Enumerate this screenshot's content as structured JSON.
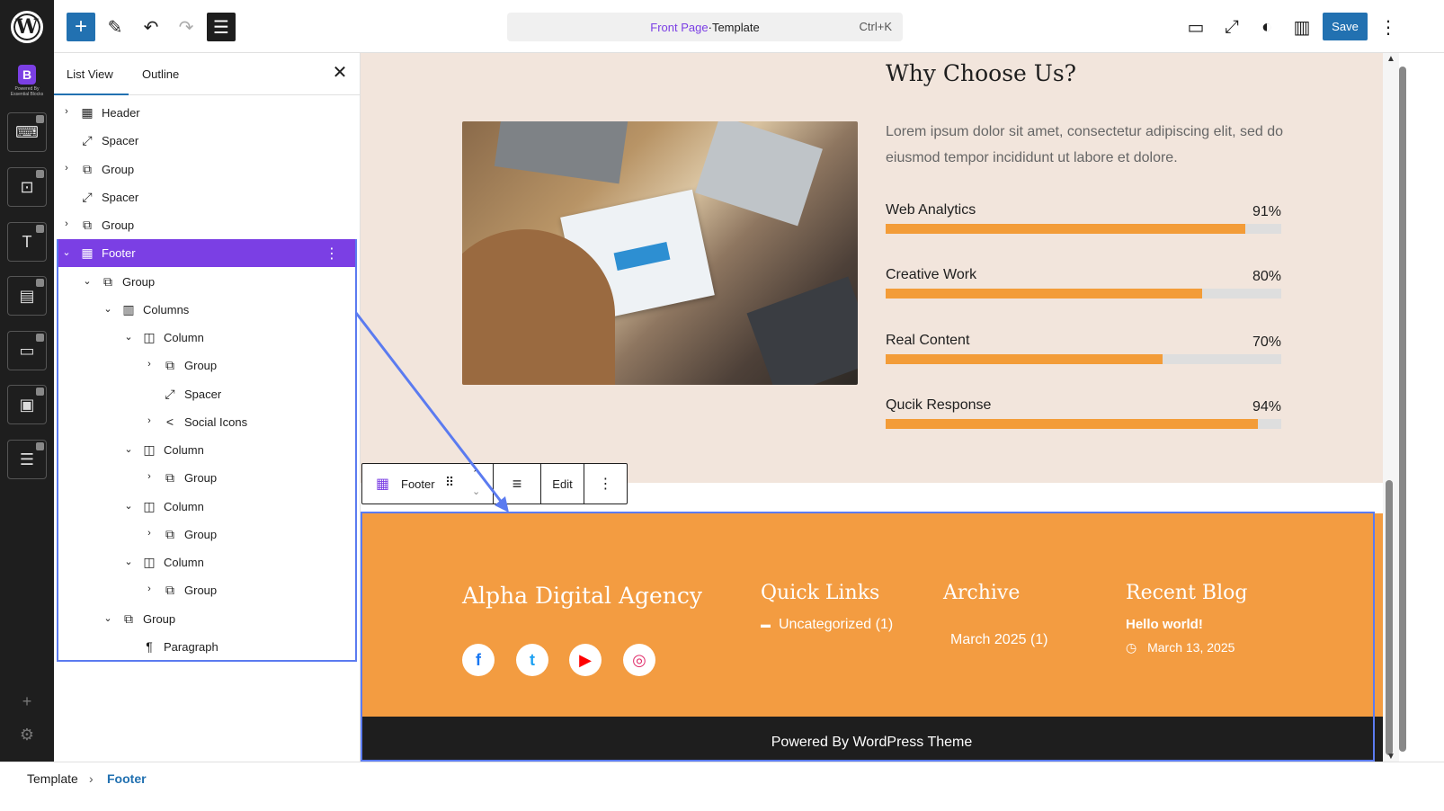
{
  "topbar": {
    "add_icon": "+",
    "pen_icon": "✎",
    "undo_icon": "↶",
    "redo_icon": "↷",
    "list_icon": "☰",
    "doc_title": "Front Page",
    "doc_separator": " · ",
    "doc_type": "Template",
    "shortcut": "Ctrl+K",
    "save_label": "Save",
    "desktop_icon": "▭",
    "fullscreen_icon": "⤢",
    "styles_icon": "◐",
    "settings_icon": "▥",
    "more_icon": "⋮"
  },
  "leftbar": {
    "wp_logo": "W",
    "eb_mark": "B",
    "eb_caption": "Powered By Essential Blocks",
    "tools": [
      "⌨",
      "⊡",
      "T",
      "▤",
      "▭",
      "▣",
      "☰"
    ],
    "add_icon": "+",
    "gear_icon": "⚙"
  },
  "panel": {
    "tab_list": "List View",
    "tab_outline": "Outline",
    "close_icon": "✕",
    "items": [
      {
        "label": "Header",
        "icon": "▦",
        "chev": "›",
        "level": 0
      },
      {
        "label": "Spacer",
        "icon": "⤢",
        "chev": "",
        "level": 0
      },
      {
        "label": "Group",
        "icon": "⧉",
        "chev": "›",
        "level": 0
      },
      {
        "label": "Spacer",
        "icon": "⤢",
        "chev": "",
        "level": 0
      },
      {
        "label": "Group",
        "icon": "⧉",
        "chev": "›",
        "level": 0
      },
      {
        "label": "Footer",
        "icon": "▦",
        "chev": "⌄",
        "level": 0
      },
      {
        "label": "Group",
        "icon": "⧉",
        "chev": "⌄",
        "level": 1
      },
      {
        "label": "Columns",
        "icon": "▥",
        "chev": "⌄",
        "level": 2
      },
      {
        "label": "Column",
        "icon": "◫",
        "chev": "⌄",
        "level": 3
      },
      {
        "label": "Group",
        "icon": "⧉",
        "chev": "›",
        "level": 4
      },
      {
        "label": "Spacer",
        "icon": "⤢",
        "chev": "",
        "level": 4
      },
      {
        "label": "Social Icons",
        "icon": "<",
        "chev": "›",
        "level": 4
      },
      {
        "label": "Column",
        "icon": "◫",
        "chev": "⌄",
        "level": 3
      },
      {
        "label": "Group",
        "icon": "⧉",
        "chev": "›",
        "level": 4
      },
      {
        "label": "Column",
        "icon": "◫",
        "chev": "⌄",
        "level": 3
      },
      {
        "label": "Group",
        "icon": "⧉",
        "chev": "›",
        "level": 4
      },
      {
        "label": "Column",
        "icon": "◫",
        "chev": "⌄",
        "level": 3
      },
      {
        "label": "Group",
        "icon": "⧉",
        "chev": "›",
        "level": 4
      },
      {
        "label": "Group",
        "icon": "⧉",
        "chev": "⌄",
        "level": 2
      },
      {
        "label": "Paragraph",
        "icon": "¶",
        "chev": "",
        "level": 3
      }
    ],
    "kebab": "⋮"
  },
  "why": {
    "title": "Why Choose Us?",
    "text": "Lorem ipsum dolor sit amet, consectetur adipiscing elit, sed do eiusmod tempor incididunt ut labore et dolore.",
    "skills": [
      {
        "name": "Web Analytics",
        "pct": "91%",
        "value": 0.91
      },
      {
        "name": "Creative Work",
        "pct": "80%",
        "value": 0.8
      },
      {
        "name": "Real Content",
        "pct": "70%",
        "value": 0.7
      },
      {
        "name": "Qucik Response",
        "pct": "94%",
        "value": 0.94
      }
    ]
  },
  "block_toolbar": {
    "icon": "▦",
    "label": "Footer",
    "drag_icon": "⠿",
    "up_icon": "⌃",
    "down_icon": "⌄",
    "align_icon": "≡",
    "edit_label": "Edit",
    "more_icon": "⋮"
  },
  "footer": {
    "brand": "Alpha Digital Agency",
    "social": [
      {
        "name": "facebook",
        "glyph": "f",
        "color": "#1877f2"
      },
      {
        "name": "twitter",
        "glyph": "t",
        "color": "#1da1f2"
      },
      {
        "name": "youtube",
        "glyph": "▶",
        "color": "#ff0000"
      },
      {
        "name": "instagram",
        "glyph": "◎",
        "color": "#e1306c"
      }
    ],
    "quick_links_title": "Quick Links",
    "quick_link": "Uncategorized (1)",
    "folder_icon": "▬",
    "archive_title": "Archive",
    "archive_item": "March 2025 (1)",
    "recent_title": "Recent Blog",
    "post_title": "Hello world!",
    "clock_icon": "◷",
    "post_date": "March 13, 2025",
    "copyright": "Powered By WordPress Theme"
  },
  "breadcrumb": {
    "root": "Template",
    "separator": "›",
    "current": "Footer"
  },
  "colors": {
    "accent": "#2271b1",
    "selection": "#7b3fe4",
    "footer_bg": "#f39c41",
    "progress": "#f39c38"
  }
}
